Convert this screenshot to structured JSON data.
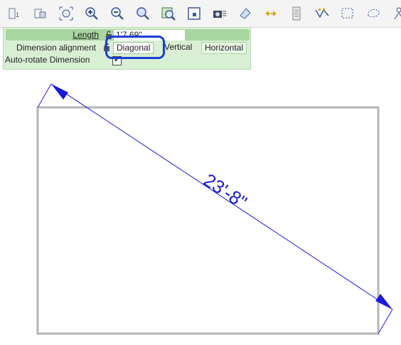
{
  "toolbar": {
    "icons": [
      "select-object-icon",
      "select-group-icon",
      "fit-window-icon",
      "zoom-in-icon",
      "zoom-out-icon",
      "zoom-fit-icon",
      "zoom-selection-icon",
      "frame-icon",
      "camera-icon",
      "edit-tool-icon",
      "dimension-arrows-icon",
      "list-icon",
      "polyline-icon",
      "rect-select-icon",
      "lasso-select-icon",
      "person-icon"
    ]
  },
  "panel": {
    "length_label": "Length",
    "length_value": "1'7.69\"",
    "alignment_label": "Dimension alignment",
    "alignment_options": [
      "Diagonal",
      "Vertical",
      "Horizontal"
    ],
    "selected_alignment": "Diagonal",
    "auto_rotate_label": "Auto-rotate Dimension",
    "auto_rotate_checked": "✔"
  },
  "drawing": {
    "dimension_text": "23'-8\"",
    "dimension_color": "#1a1adb",
    "rectangle_color": "#b5b5b5"
  }
}
